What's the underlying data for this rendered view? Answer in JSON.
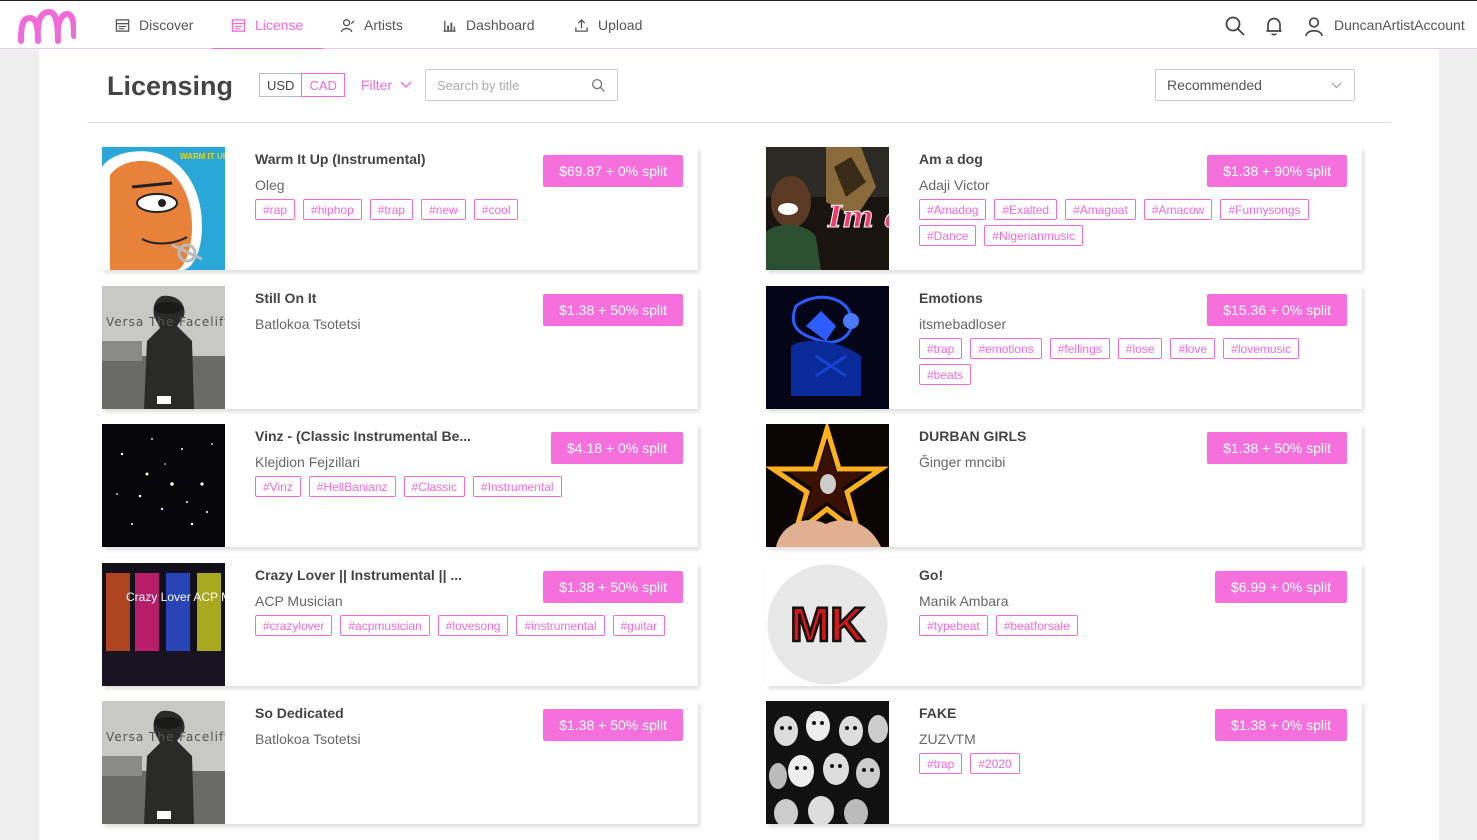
{
  "nav": {
    "items": [
      {
        "label": "Discover",
        "icon": "discover-icon"
      },
      {
        "label": "License",
        "icon": "license-icon"
      },
      {
        "label": "Artists",
        "icon": "artists-icon"
      },
      {
        "label": "Dashboard",
        "icon": "dashboard-icon"
      },
      {
        "label": "Upload",
        "icon": "upload-icon"
      }
    ],
    "active": "License",
    "username": "DuncanArtistAccount",
    "accent": "#f06ad8"
  },
  "toolbar": {
    "title": "Licensing",
    "currencies": [
      "USD",
      "CAD"
    ],
    "selected_currency": "CAD",
    "filter_label": "Filter",
    "search_placeholder": "Search by title",
    "sort_value": "Recommended"
  },
  "tracks": [
    {
      "title": "Warm It Up (Instrumental)",
      "artist": "Oleg",
      "price": "$69.87 + 0% split",
      "tags": [
        "#rap",
        "#hiphop",
        "#trap",
        "#new",
        "#cool"
      ],
      "cover": "warm-it-up-cover",
      "cover_text": "WARM IT UP"
    },
    {
      "title": "Am a dog",
      "artist": "Adaji Victor",
      "price": "$1.38 + 90% split",
      "tags": [
        "#Amadog",
        "#Exalted",
        "#Amagoat",
        "#Amacow",
        "#Funnysongs",
        "#Dance",
        "#Nigerianmusic"
      ],
      "cover": "am-a-dog-cover",
      "cover_text": "Im a Dog"
    },
    {
      "title": "Still On It",
      "artist": "Batlokoa Tsotetsi",
      "price": "$1.38 + 50% split",
      "tags": [],
      "cover": "the-facelift-cover",
      "cover_text": "Versa The Facelift"
    },
    {
      "title": "Emotions",
      "artist": "itsmebadloser",
      "price": "$15.36 + 0% split",
      "tags": [
        "#trap",
        "#emotions",
        "#fellings",
        "#lose",
        "#love",
        "#lovemusic",
        "#beats"
      ],
      "cover": "emotions-cover",
      "cover_text": ""
    },
    {
      "title": "Vinz - (Classic Instrumental Be...",
      "artist": "Klejdion Fejzillari",
      "price": "$4.18 + 0% split",
      "tags": [
        "#Vinz",
        "#HellBanianz",
        "#Classic",
        "#Instrumental"
      ],
      "cover": "vinz-cover",
      "cover_text": ""
    },
    {
      "title": "DURBAN GIRLS",
      "artist": "Ğinger mncibi",
      "price": "$1.38 + 50% split",
      "tags": [],
      "cover": "durban-girls-cover",
      "cover_text": ""
    },
    {
      "title": "Crazy Lover || Instrumental || ...",
      "artist": "ACP Musician",
      "price": "$1.38 + 50% split",
      "tags": [
        "#crazylover",
        "#acpmusician",
        "#lovesong",
        "#instrumental",
        "#guitar"
      ],
      "cover": "crazy-lover-cover",
      "cover_text": "Crazy Lover ACP Musician"
    },
    {
      "title": "Go!",
      "artist": "Manik Ambara",
      "price": "$6.99 + 0% split",
      "tags": [
        "#typebeat",
        "#beatforsale"
      ],
      "cover": "mk-cover",
      "cover_text": "MK"
    },
    {
      "title": "So Dedicated",
      "artist": "Batlokoa Tsotetsi",
      "price": "$1.38 + 50% split",
      "tags": [],
      "cover": "the-facelift-cover",
      "cover_text": "Versa The Facelift"
    },
    {
      "title": "FAKE",
      "artist": "ZUZVTM",
      "price": "$1.38 + 0% split",
      "tags": [
        "#trap",
        "#2020"
      ],
      "cover": "fake-cover",
      "cover_text": ""
    }
  ]
}
